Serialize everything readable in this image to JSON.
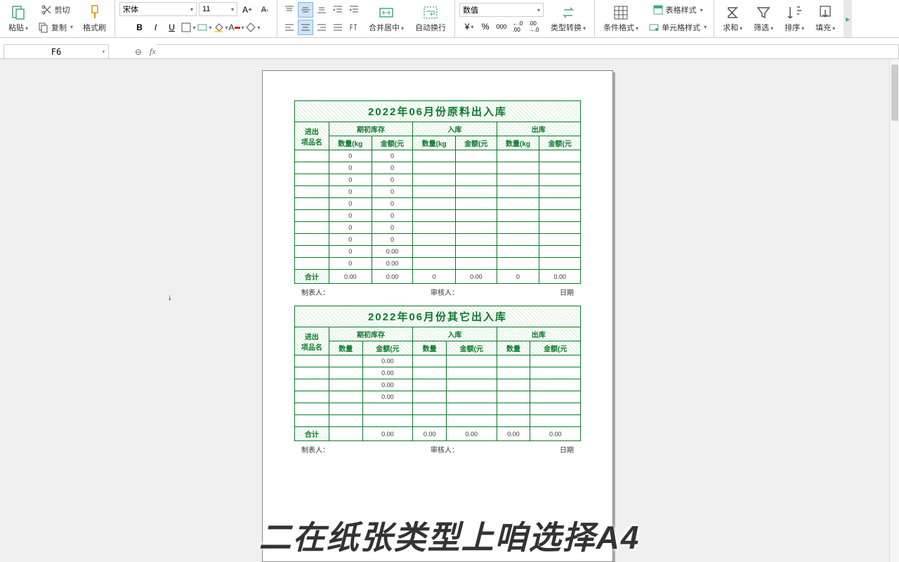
{
  "ribbon": {
    "cut": "剪切",
    "copy": "复制",
    "paste": "粘贴",
    "format_painter": "格式刷",
    "font": "宋体",
    "font_size": "11",
    "merge_center": "合并居中",
    "wrap_text": "自动换行",
    "number_format": "数值",
    "type_convert": "类型转换",
    "cond_fmt": "条件格式",
    "table_style": "表格样式",
    "cell_style": "单元格样式",
    "sum": "求和",
    "filter": "筛选",
    "sort": "排序",
    "fill": "填充"
  },
  "formula_bar": {
    "cell_ref": "F6"
  },
  "table1": {
    "title": "2022年06月份原料出入库",
    "corner1": "进出",
    "corner2": "项品名",
    "group_headers": [
      "期初库存",
      "入库",
      "出库"
    ],
    "sub_kg": "数量(kg",
    "sub_amt": "金额(元",
    "rows": [
      {
        "q1": "0",
        "a1": "0",
        "q2": "",
        "a2": "",
        "q3": "",
        "a3": ""
      },
      {
        "q1": "0",
        "a1": "0",
        "q2": "",
        "a2": "",
        "q3": "",
        "a3": ""
      },
      {
        "q1": "0",
        "a1": "0",
        "q2": "",
        "a2": "",
        "q3": "",
        "a3": ""
      },
      {
        "q1": "0",
        "a1": "0",
        "q2": "",
        "a2": "",
        "q3": "",
        "a3": ""
      },
      {
        "q1": "0",
        "a1": "0",
        "q2": "",
        "a2": "",
        "q3": "",
        "a3": ""
      },
      {
        "q1": "0",
        "a1": "0",
        "q2": "",
        "a2": "",
        "q3": "",
        "a3": ""
      },
      {
        "q1": "0",
        "a1": "0",
        "q2": "",
        "a2": "",
        "q3": "",
        "a3": ""
      },
      {
        "q1": "0",
        "a1": "0",
        "q2": "",
        "a2": "",
        "q3": "",
        "a3": ""
      },
      {
        "q1": "0",
        "a1": "0.00",
        "q2": "",
        "a2": "",
        "q3": "",
        "a3": ""
      },
      {
        "q1": "0",
        "a1": "0.00",
        "q2": "",
        "a2": "",
        "q3": "",
        "a3": ""
      }
    ],
    "total_label": "合计",
    "total": {
      "q1": "0.00",
      "a1": "0.00",
      "q2": "0",
      "a2": "0.00",
      "q3": "0",
      "a3": "0.00"
    }
  },
  "table2": {
    "title": "2022年06月份其它出入库",
    "corner1": "进出",
    "corner2": "项品名",
    "group_headers": [
      "期初库存",
      "入库",
      "出库"
    ],
    "sub_qty": "数量",
    "sub_amt": "金额(元",
    "rows": [
      {
        "a1": "0.00"
      },
      {
        "a1": "0.00"
      },
      {
        "a1": "0.00"
      },
      {
        "a1": "0.00"
      },
      {
        "a1": ""
      },
      {
        "a1": ""
      }
    ],
    "total_label": "合计",
    "total": {
      "q1": "",
      "a1": "0.00",
      "q2": "0.00",
      "a2": "0.00",
      "q3": "0.00",
      "a3": "0.00"
    }
  },
  "footer": {
    "maker": "制表人：",
    "reviewer": "审核人：",
    "date": "日期"
  },
  "caption": "二在纸张类型上咱选择A4"
}
